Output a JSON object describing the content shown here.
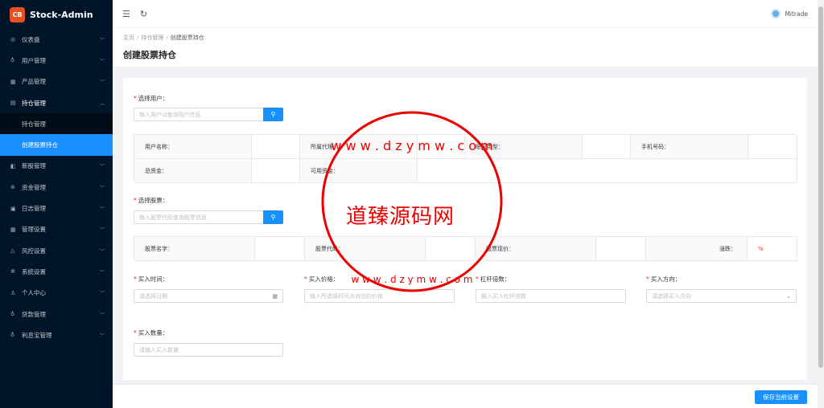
{
  "brand": {
    "logo_text": "CB",
    "name": "Stock-Admin"
  },
  "sidebar": {
    "items": [
      {
        "label": "仪表盘",
        "icon": "dashboard-icon",
        "glyph": "◎"
      },
      {
        "label": "用户管理",
        "icon": "user-group-icon",
        "glyph": "♁"
      },
      {
        "label": "产品管理",
        "icon": "chart-icon",
        "glyph": "▦"
      },
      {
        "label": "持仓管理",
        "icon": "position-icon",
        "glyph": "▤"
      },
      {
        "label": "新股管理",
        "icon": "new-stock-icon",
        "glyph": "◧"
      },
      {
        "label": "资金管理",
        "icon": "money-icon",
        "glyph": "⊜"
      },
      {
        "label": "日志管理",
        "icon": "log-icon",
        "glyph": "▣"
      },
      {
        "label": "管理设置",
        "icon": "settings-icon",
        "glyph": "▦"
      },
      {
        "label": "风控设置",
        "icon": "warning-icon",
        "glyph": "△"
      },
      {
        "label": "系统设置",
        "icon": "gear-icon",
        "glyph": "✲"
      },
      {
        "label": "个人中心",
        "icon": "person-icon",
        "glyph": "♙"
      },
      {
        "label": "贷款管理",
        "icon": "loan-icon",
        "glyph": "♁"
      },
      {
        "label": "利息宝管理",
        "icon": "interest-icon",
        "glyph": "♁"
      }
    ],
    "submenu": [
      {
        "label": "持仓管理"
      },
      {
        "label": "创建股票持仓"
      }
    ]
  },
  "header": {
    "user_name": "Mitrade"
  },
  "breadcrumb": {
    "home": "主页",
    "parent": "持仓管理",
    "current": "创建股票持仓"
  },
  "page": {
    "title": "创建股票持仓"
  },
  "form": {
    "select_user_label": "选择用户：",
    "user_search_placeholder": "输入用户id查询用户信息",
    "user_info": {
      "name_label": "用户名称：",
      "agent_label": "所属代理：",
      "account_type_label": "账号类型：",
      "phone_label": "手机号码：",
      "total_label": "总资金：",
      "available_label": "可用资金："
    },
    "select_stock_label": "选择股票：",
    "stock_search_placeholder": "输入股票代码查询股票信息",
    "stock_info": {
      "name_label": "股票名字：",
      "code_label": "股票代码：",
      "price_label": "股票现价：",
      "change_label": "涨跌：",
      "change_value": "%"
    },
    "buy_time_label": "买入时间：",
    "buy_time_placeholder": "请选择日期",
    "buy_price_label": "买入价格：",
    "buy_price_placeholder": "输入所选择时间点对应的价格",
    "leverage_label": "杠杆倍数：",
    "leverage_placeholder": "输入买入杠杆倍数",
    "direction_label": "买入方向：",
    "direction_placeholder": "请选择买入方向",
    "quantity_label": "买入数量：",
    "quantity_placeholder": "请输入买入数量"
  },
  "footer": {
    "save_label": "保存当前设置"
  },
  "watermark": {
    "brand": "道臻源码网",
    "domain": "w w w . d z y m w . c o m"
  }
}
